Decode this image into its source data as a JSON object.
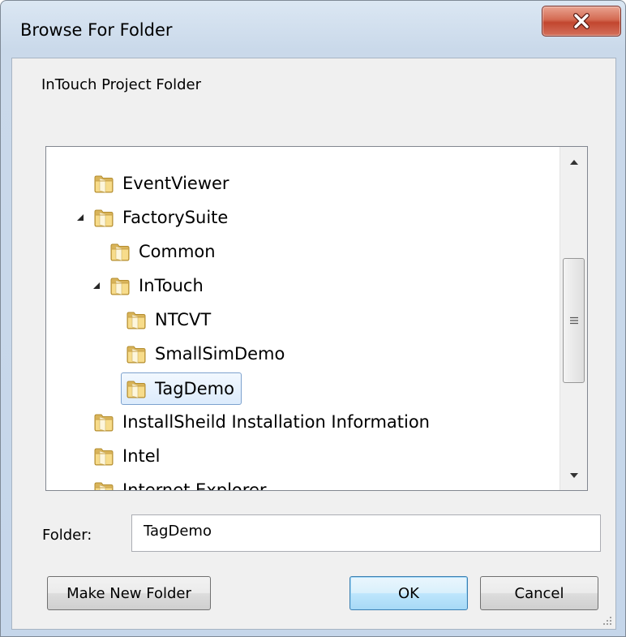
{
  "window": {
    "title": "Browse For Folder",
    "close_icon": "close-x-icon"
  },
  "dialog": {
    "instruction": "InTouch Project Folder"
  },
  "tree": {
    "items": [
      {
        "label": "EventViewer",
        "level": 1,
        "expander": "none"
      },
      {
        "label": "FactorySuite",
        "level": 1,
        "expander": "expanded"
      },
      {
        "label": "Common",
        "level": 2,
        "expander": "none"
      },
      {
        "label": "InTouch",
        "level": 2,
        "expander": "expanded"
      },
      {
        "label": "NTCVT",
        "level": 3,
        "expander": "none"
      },
      {
        "label": "SmallSimDemo",
        "level": 3,
        "expander": "none"
      },
      {
        "label": "TagDemo",
        "level": 3,
        "expander": "none",
        "selected": true
      },
      {
        "label": "InstallSheild Installation Information",
        "level": 1,
        "expander": "none"
      },
      {
        "label": "Intel",
        "level": 1,
        "expander": "none"
      },
      {
        "label": "Internet Explorer",
        "level": 1,
        "expander": "none"
      }
    ],
    "icon": "folder-icon"
  },
  "folder_field": {
    "label": "Folder:",
    "value": "TagDemo"
  },
  "buttons": {
    "make_new_folder": "Make New Folder",
    "ok": "OK",
    "cancel": "Cancel"
  },
  "colors": {
    "selection_border": "#7da2ce",
    "close_button": "#c2462f",
    "default_button_border": "#3c7fb1"
  }
}
